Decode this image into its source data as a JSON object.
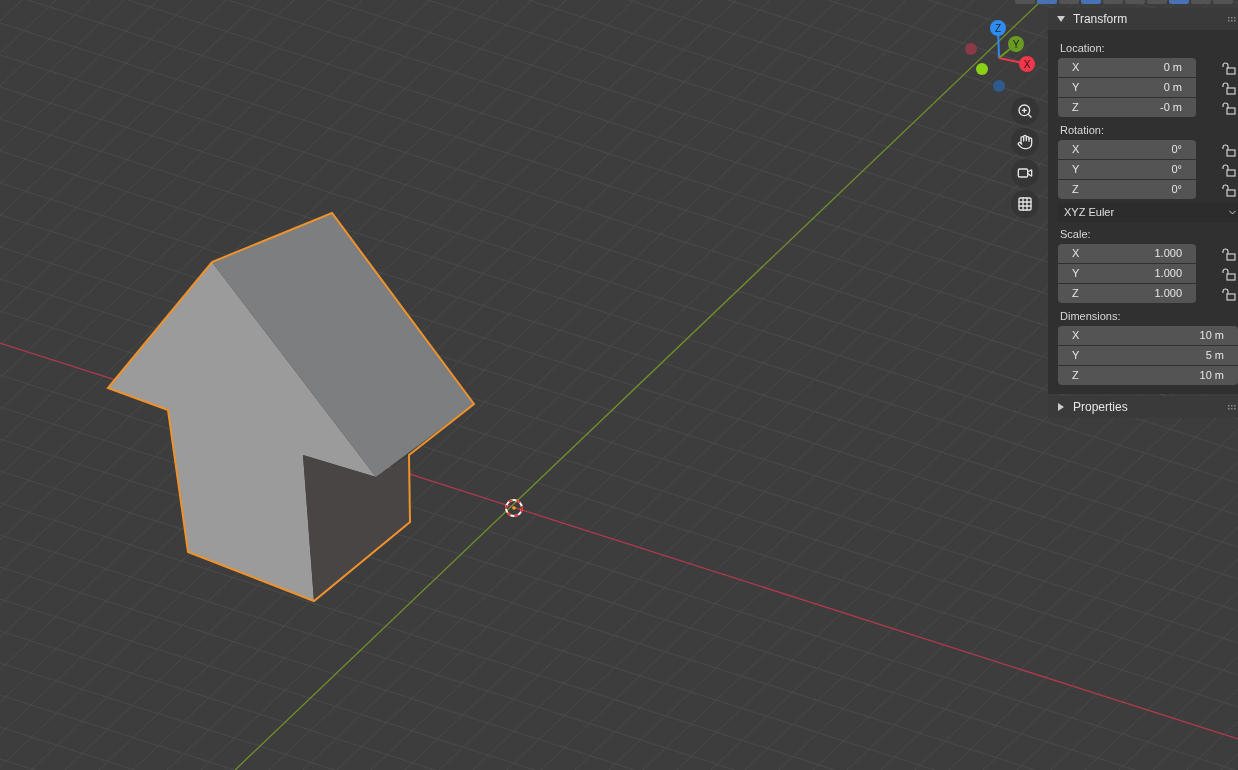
{
  "header_buttons": [
    {
      "selected": false
    },
    {
      "selected": true
    },
    {
      "selected": false
    },
    {
      "selected": true
    },
    {
      "selected": false
    },
    {
      "selected": false
    },
    {
      "selected": false
    },
    {
      "selected": true
    },
    {
      "selected": false
    },
    {
      "selected": false
    }
  ],
  "gizmo": {
    "z": "Z",
    "y": "Y",
    "x": "X"
  },
  "sidebar": {
    "panels": [
      {
        "title": "Transform",
        "expanded": true,
        "groups": [
          {
            "label": "Location:",
            "kind": "vector",
            "rows": [
              {
                "axis": "X",
                "value": "0 m",
                "locked": false
              },
              {
                "axis": "Y",
                "value": "0 m",
                "locked": false
              },
              {
                "axis": "Z",
                "value": "-0 m",
                "locked": false
              }
            ]
          },
          {
            "label": "Rotation:",
            "kind": "vector",
            "rows": [
              {
                "axis": "X",
                "value": "0°",
                "locked": false
              },
              {
                "axis": "Y",
                "value": "0°",
                "locked": false
              },
              {
                "axis": "Z",
                "value": "0°",
                "locked": false
              }
            ],
            "mode": "XYZ Euler"
          },
          {
            "label": "Scale:",
            "kind": "vector",
            "rows": [
              {
                "axis": "X",
                "value": "1.000",
                "locked": false
              },
              {
                "axis": "Y",
                "value": "1.000",
                "locked": false
              },
              {
                "axis": "Z",
                "value": "1.000",
                "locked": false
              }
            ]
          },
          {
            "label": "Dimensions:",
            "kind": "wide",
            "rows": [
              {
                "axis": "X",
                "value": "10 m"
              },
              {
                "axis": "Y",
                "value": "5 m"
              },
              {
                "axis": "Z",
                "value": "10 m"
              }
            ]
          }
        ]
      },
      {
        "title": "Properties",
        "expanded": false
      }
    ]
  }
}
